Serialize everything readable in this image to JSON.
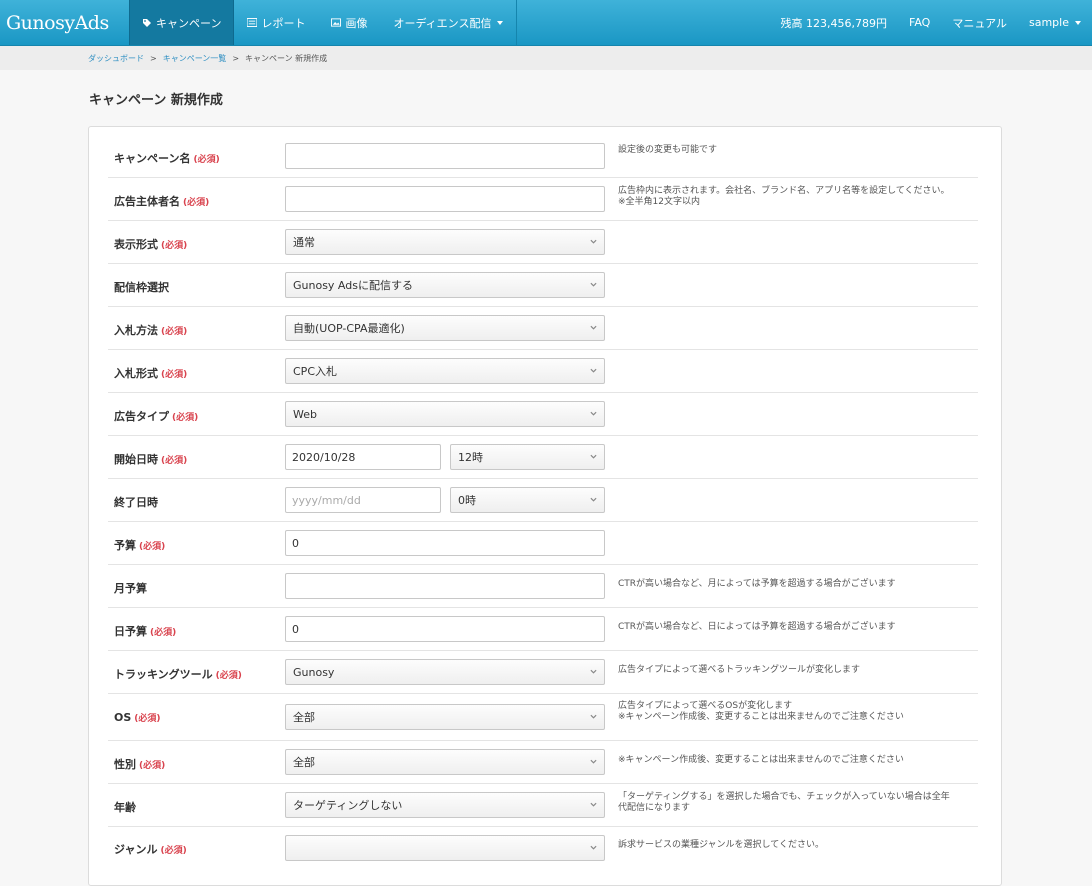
{
  "nav": {
    "brand": "GunosyAds",
    "items": [
      {
        "label": "キャンペーン",
        "icon": "tag-icon"
      },
      {
        "label": "レポート",
        "icon": "list-icon"
      },
      {
        "label": "画像",
        "icon": "image-icon"
      },
      {
        "label": "オーディエンス配信",
        "icon": "caret-down-icon"
      }
    ],
    "balance": "残高 123,456,789円",
    "faq": "FAQ",
    "manual": "マニュアル",
    "user": "sample"
  },
  "breadcrumb": {
    "dashboard": "ダッシュボード",
    "sep": ">",
    "campaigns": "キャンペーン一覧",
    "current": "キャンペーン 新規作成"
  },
  "page_title": "キャンペーン 新規作成",
  "required_label": "(必須)",
  "fields": {
    "campaign_name": {
      "label": "キャンペーン名",
      "value": "",
      "help": "設定後の変更も可能です"
    },
    "advertiser_name": {
      "label": "広告主体者名",
      "value": "",
      "help1": "広告枠内に表示されます。会社名、ブランド名、アプリ名等を設定してください。",
      "help2": "※全半角12文字以内"
    },
    "display_format": {
      "label": "表示形式",
      "value": "通常"
    },
    "placement": {
      "label": "配信枠選択",
      "value": "Gunosy Adsに配信する"
    },
    "bid_method": {
      "label": "入札方法",
      "value": "自動(UOP-CPA最適化)"
    },
    "bid_format": {
      "label": "入札形式",
      "value": "CPC入札"
    },
    "ad_type": {
      "label": "広告タイプ",
      "value": "Web"
    },
    "start": {
      "label": "開始日時",
      "date": "2020/10/28",
      "hour": "12時"
    },
    "end": {
      "label": "終了日時",
      "placeholder": "yyyy/mm/dd",
      "hour": "0時"
    },
    "budget": {
      "label": "予算",
      "value": "0"
    },
    "monthly_budget": {
      "label": "月予算",
      "value": "",
      "help": "CTRが高い場合など、月によっては予算を超過する場合がございます"
    },
    "daily_budget": {
      "label": "日予算",
      "value": "0",
      "help": "CTRが高い場合など、日によっては予算を超過する場合がございます"
    },
    "tracking": {
      "label": "トラッキングツール",
      "value": "Gunosy",
      "help": "広告タイプによって選べるトラッキングツールが変化します"
    },
    "os": {
      "label": "OS",
      "value": "全部",
      "help1": "広告タイプによって選べるOSが変化します",
      "help2": "※キャンペーン作成後、変更することは出来ませんのでご注意ください"
    },
    "gender": {
      "label": "性別",
      "value": "全部",
      "help": "※キャンペーン作成後、変更することは出来ませんのでご注意ください"
    },
    "age": {
      "label": "年齢",
      "value": "ターゲティングしない",
      "help1": "「ターゲティングする」を選択した場合でも、チェックが入っていない場合は全年",
      "help2": "代配信になります"
    },
    "genre": {
      "label": "ジャンル",
      "value": "",
      "help": "訴求サービスの業種ジャンルを選択してください。"
    }
  }
}
